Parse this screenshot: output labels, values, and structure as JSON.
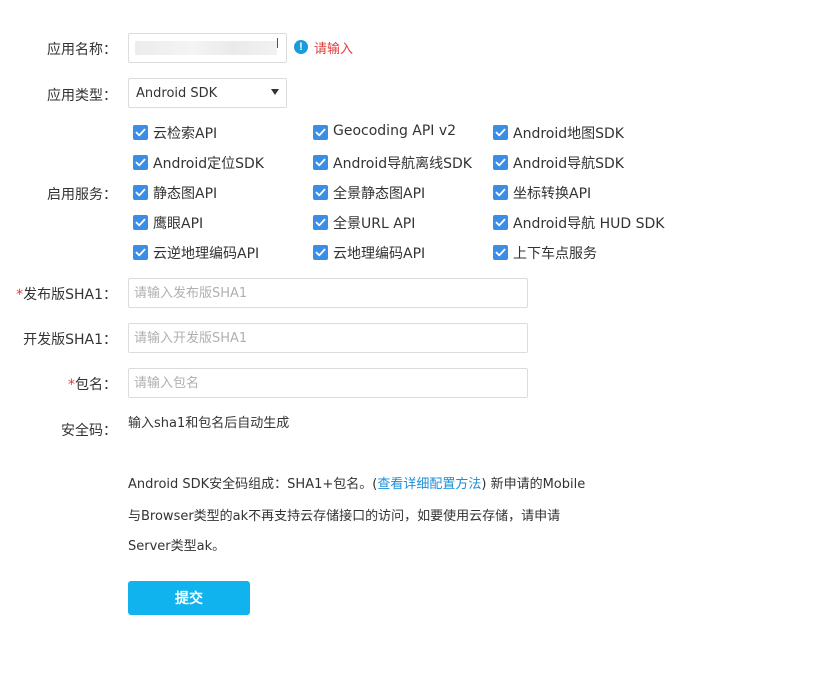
{
  "form": {
    "app_name": {
      "label": "应用名称：",
      "value": "",
      "warning": "请输入",
      "warning_icon": "exclamation-circle-icon"
    },
    "app_type": {
      "label": "应用类型：",
      "selected": "Android SDK"
    },
    "services": {
      "label": "启用服务：",
      "items": [
        {
          "label": "云检索API",
          "checked": true
        },
        {
          "label": "Geocoding API v2",
          "checked": true
        },
        {
          "label": "Android地图SDK",
          "checked": true
        },
        {
          "label": "Android定位SDK",
          "checked": true
        },
        {
          "label": "Android导航离线SDK",
          "checked": true
        },
        {
          "label": "Android导航SDK",
          "checked": true
        },
        {
          "label": "静态图API",
          "checked": true
        },
        {
          "label": "全景静态图API",
          "checked": true
        },
        {
          "label": "坐标转换API",
          "checked": true
        },
        {
          "label": "鹰眼API",
          "checked": true
        },
        {
          "label": "全景URL API",
          "checked": true
        },
        {
          "label": "Android导航 HUD SDK",
          "checked": true
        },
        {
          "label": "云逆地理编码API",
          "checked": true
        },
        {
          "label": "云地理编码API",
          "checked": true
        },
        {
          "label": "上下车点服务",
          "checked": true
        }
      ]
    },
    "release_sha1": {
      "required_mark": "*",
      "label": "发布版SHA1：",
      "placeholder": "请输入发布版SHA1",
      "value": ""
    },
    "dev_sha1": {
      "label": "开发版SHA1：",
      "placeholder": "请输入开发版SHA1",
      "value": ""
    },
    "package": {
      "required_mark": "*",
      "label": "包名：",
      "placeholder": "请输入包名",
      "value": ""
    },
    "security_code": {
      "label": "安全码：",
      "hint": "输入sha1和包名后自动生成"
    },
    "note": {
      "line1_prefix": "Android SDK安全码组成：SHA1+包名。(",
      "link": "查看详细配置方法",
      "line1_suffix": ") 新申请的Mobile",
      "line2": "与Browser类型的ak不再支持云存储接口的访问，如要使用云存储，请申请",
      "line3": "Server类型ak。"
    },
    "submit_label": "提交"
  },
  "colors": {
    "accent": "#11b3ee",
    "checkbox": "#3a8ee6",
    "error": "#e23b3b",
    "link": "#1a8fd9"
  }
}
